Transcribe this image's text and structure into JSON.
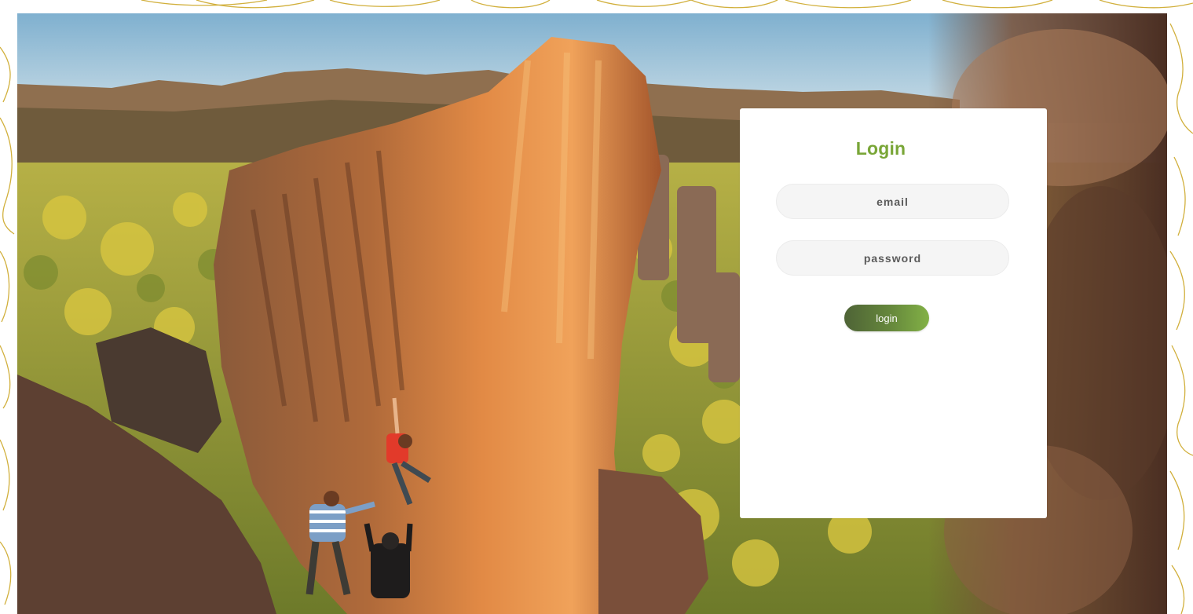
{
  "colors": {
    "accent": "#79a637",
    "topo_line": "#c9a21a",
    "button_gradient_start": "#4e6336",
    "button_gradient_end": "#82b146",
    "field_bg": "#f5f5f5",
    "card_bg": "#ffffff"
  },
  "background": {
    "pattern": "topographic-contour-lines",
    "photo": "climber-on-orange-boulder"
  },
  "login_card": {
    "title": "Login",
    "email_placeholder": "email",
    "password_placeholder": "password",
    "submit_label": "login"
  }
}
